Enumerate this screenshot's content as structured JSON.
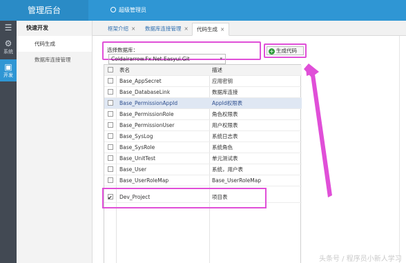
{
  "header": {
    "app_title": "管理后台",
    "user_name": "超级管理员"
  },
  "rail": {
    "items": [
      {
        "label": "系统",
        "icon": "gear-icon"
      },
      {
        "label": "开发",
        "icon": "cube-icon"
      }
    ]
  },
  "menu": {
    "section_title": "快速开发",
    "items": [
      {
        "label": "代码生成"
      },
      {
        "label": "数据库连接管理"
      }
    ]
  },
  "tabs": [
    {
      "label": "框架介绍"
    },
    {
      "label": "数据库连接管理"
    },
    {
      "label": "代码生成"
    }
  ],
  "tab_close": "×",
  "toolbar": {
    "db_label": "选择数据库：",
    "db_value": "Coldairarrow.Fx.Net.Easyui.Git",
    "generate_label": "生成代码"
  },
  "table": {
    "columns": [
      "表名",
      "描述"
    ],
    "rows": [
      {
        "name": "Base_AppSecret",
        "desc": "应用密钥"
      },
      {
        "name": "Base_DatabaseLink",
        "desc": "数据库连接"
      },
      {
        "name": "Base_PermissionAppId",
        "desc": "AppId权限表"
      },
      {
        "name": "Base_PermissionRole",
        "desc": "角色权限表"
      },
      {
        "name": "Base_PermissionUser",
        "desc": "用户权限表"
      },
      {
        "name": "Base_SysLog",
        "desc": "系统日志表"
      },
      {
        "name": "Base_SysRole",
        "desc": "系统角色"
      },
      {
        "name": "Base_UnitTest",
        "desc": "单元测试表"
      },
      {
        "name": "Base_User",
        "desc": "系统，用户表"
      },
      {
        "name": "Base_UserRoleMap",
        "desc": "Base_UserRoleMap"
      },
      {
        "name": "Dev_Project",
        "desc": "项目表"
      }
    ],
    "checked_row": "Dev_Project",
    "highlighted_row": "Base_PermissionAppId"
  },
  "watermark": "头条号 / 程序员小新人学习",
  "colors": {
    "header_blue": "#2f96d4",
    "annotation_magenta": "#e04fd8"
  }
}
